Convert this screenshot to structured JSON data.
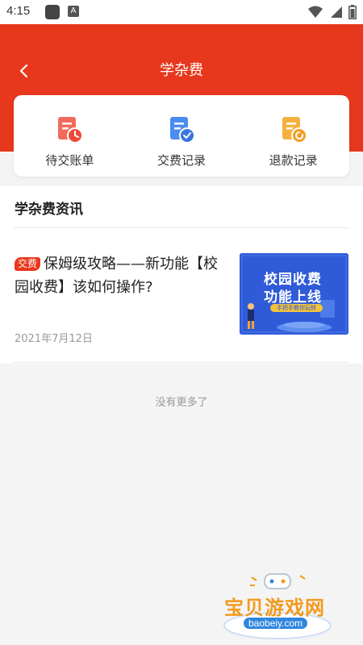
{
  "status_bar": {
    "time": "4:15",
    "icons": [
      "app-icon",
      "a-icon",
      "wifi-icon",
      "signal-icon",
      "battery-icon"
    ]
  },
  "header": {
    "title": "学杂费",
    "back_icon": "chevron-left-icon",
    "background_color": "#e7371c"
  },
  "quick_actions": [
    {
      "label": "待交账单",
      "icon": "pending-bill-icon",
      "color": "#f26a5b"
    },
    {
      "label": "交费记录",
      "icon": "payment-record-icon",
      "color": "#4a8cf0"
    },
    {
      "label": "退款记录",
      "icon": "refund-record-icon",
      "color": "#f5b13e"
    }
  ],
  "news_section": {
    "title": "学杂费资讯",
    "items": [
      {
        "tag": "交费",
        "title": "保姆级攻略——新功能【校园收费】该如何操作?",
        "date": "2021年7月12日",
        "thumbnail": {
          "line1": "校园收费",
          "line2": "功能上线",
          "badge": "手把手教你玩转"
        }
      }
    ]
  },
  "footer": {
    "no_more_text": "没有更多了"
  },
  "watermark": {
    "text": "宝贝游戏网",
    "url": "baobeiy.com"
  }
}
